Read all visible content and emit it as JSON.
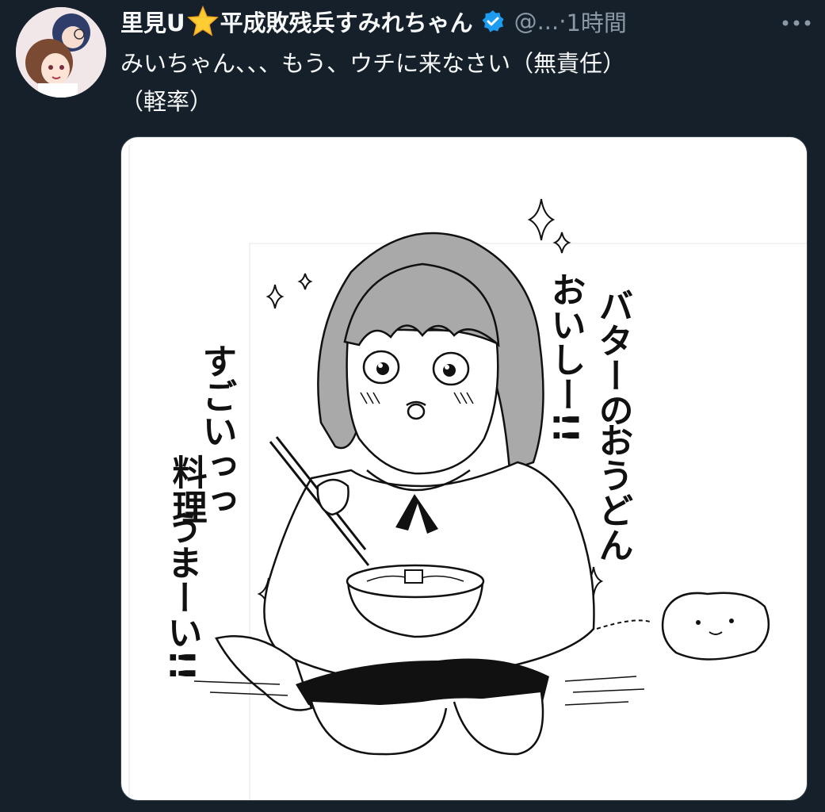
{
  "tweet": {
    "display_name": "里見U",
    "display_name_suffix": "平成敗残兵すみれちゃん",
    "handle": "@...",
    "separator": "·",
    "time": "1時間",
    "text_line1": "みいちゃん、、、もう、ウチに来なさい（無責任）",
    "text_line2": "（軽率）",
    "star_icon": "glowing-star-emoji",
    "verified_icon": "verified-badge",
    "more_icon": "more-horizontal-icon"
  },
  "illustration": {
    "speech_right_col1": "バターの",
    "speech_right_col2": "おいしー!!",
    "speech_right_col3": "おうどん",
    "speech_left_col1": "すごいっっ",
    "speech_left_col2": "料理",
    "speech_left_col3": "うまーい!!"
  },
  "colors": {
    "background": "#15202b",
    "text": "#f7f9f9",
    "secondary_text": "#8b98a5",
    "verified": "#1d9bf0"
  }
}
